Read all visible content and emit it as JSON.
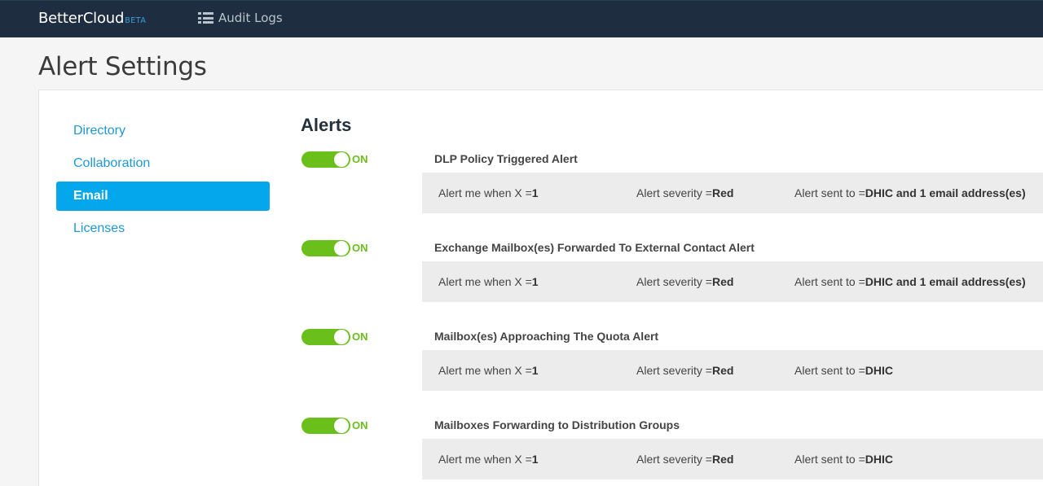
{
  "app": {
    "logo_text": "BetterCloud",
    "logo_badge": "BETA",
    "nav": {
      "audit_logs_label": "Audit Logs",
      "audit_logs_icon": "list-icon"
    }
  },
  "page": {
    "title": "Alert Settings"
  },
  "sidebar": {
    "items": [
      {
        "label": "Directory",
        "active": false
      },
      {
        "label": "Collaboration",
        "active": false
      },
      {
        "label": "Email",
        "active": true
      },
      {
        "label": "Licenses",
        "active": false
      }
    ]
  },
  "alerts_section": {
    "title": "Alerts",
    "items": [
      {
        "state": "ON",
        "name": "DLP Policy Triggered Alert",
        "condition_label": "Alert me when X =",
        "condition_value": "1",
        "severity_label": "Alert severity =",
        "severity_value": "Red",
        "sent_label": "Alert sent to =",
        "sent_value": "DHIC and 1 email address(es)"
      },
      {
        "state": "ON",
        "name": "Exchange Mailbox(es) Forwarded To External Contact Alert",
        "condition_label": "Alert me when X =",
        "condition_value": "1",
        "severity_label": "Alert severity =",
        "severity_value": "Red",
        "sent_label": "Alert sent to =",
        "sent_value": "DHIC and 1 email address(es)"
      },
      {
        "state": "ON",
        "name": "Mailbox(es) Approaching The Quota Alert",
        "condition_label": "Alert me when X =",
        "condition_value": "1",
        "severity_label": "Alert severity =",
        "severity_value": "Red",
        "sent_label": "Alert sent to =",
        "sent_value": "DHIC"
      },
      {
        "state": "ON",
        "name": "Mailboxes Forwarding to Distribution Groups",
        "condition_label": "Alert me when X =",
        "condition_value": "1",
        "severity_label": "Alert severity =",
        "severity_value": "Red",
        "sent_label": "Alert sent to =",
        "sent_value": "DHIC"
      }
    ]
  },
  "colors": {
    "topbar": "#1e2d3f",
    "accent_blue": "#04a7ec",
    "link_blue": "#1f97d6",
    "toggle_green": "#6abf1a"
  }
}
